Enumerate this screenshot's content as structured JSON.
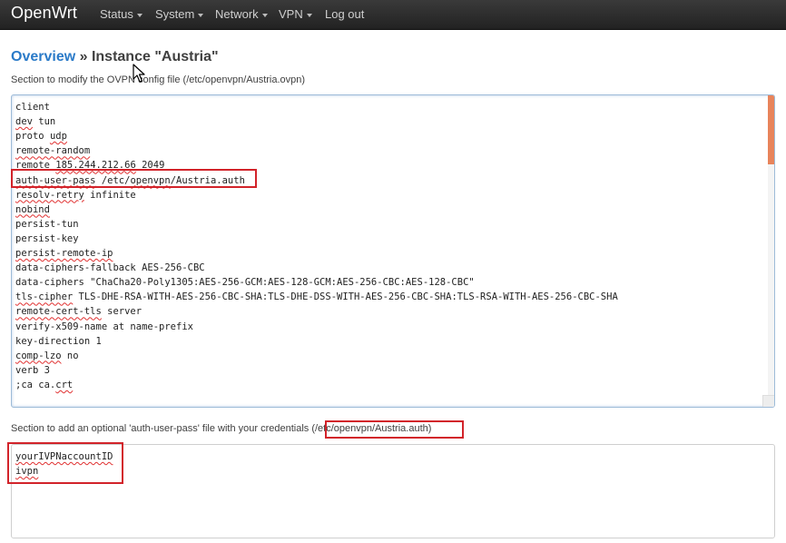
{
  "nav": {
    "brand": "OpenWrt",
    "items": [
      "Status",
      "System",
      "Network",
      "VPN",
      "Log out"
    ]
  },
  "page": {
    "crumb_link": "Overview",
    "crumb_sep": " » ",
    "crumb_current": "Instance \"Austria\"",
    "desc_config": "Section to modify the OVPN config file (/etc/openvpn/Austria.ovpn)",
    "desc_auth": "Section to add an optional 'auth-user-pass' file with your credentials (/etc/openvpn/Austria.auth)"
  },
  "config_lines": [
    "client",
    "dev tun",
    "proto udp",
    "remote-random",
    "remote 185.244.212.66 2049",
    "auth-user-pass /etc/openvpn/Austria.auth",
    "resolv-retry infinite",
    "nobind",
    "persist-tun",
    "persist-key",
    "persist-remote-ip",
    "data-ciphers-fallback AES-256-CBC",
    "data-ciphers \"ChaCha20-Poly1305:AES-256-GCM:AES-128-GCM:AES-256-CBC:AES-128-CBC\"",
    "tls-cipher TLS-DHE-RSA-WITH-AES-256-CBC-SHA:TLS-DHE-DSS-WITH-AES-256-CBC-SHA:TLS-RSA-WITH-AES-256-CBC-SHA",
    "remote-cert-tls server",
    "verify-x509-name at name-prefix",
    "key-direction 1",
    "comp-lzo no",
    "verb 3",
    ";ca ca.crt"
  ],
  "auth_lines": [
    "yourIVPNaccountID",
    "ivpn"
  ],
  "colors": {
    "accent_link": "#2a7ac8",
    "highlight_box": "#d2232a",
    "scroll_thumb": "#e8845b"
  }
}
